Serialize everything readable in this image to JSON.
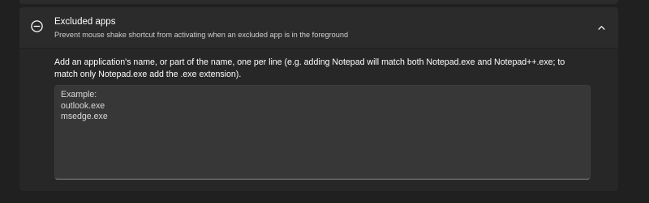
{
  "excluded_apps": {
    "title": "Excluded apps",
    "description": "Prevent mouse shake shortcut from activating when an excluded app is in the foreground",
    "icon": "block-icon",
    "chevron_icon": "chevron-up-icon",
    "instructions": "Add an application's name, or part of the name, one per line (e.g. adding Notepad will match both Notepad.exe and Notepad++.exe; to match only Notepad.exe add the .exe extension).",
    "textarea_lines": [
      "Example:",
      "outlook.exe",
      "msedge.exe"
    ]
  }
}
